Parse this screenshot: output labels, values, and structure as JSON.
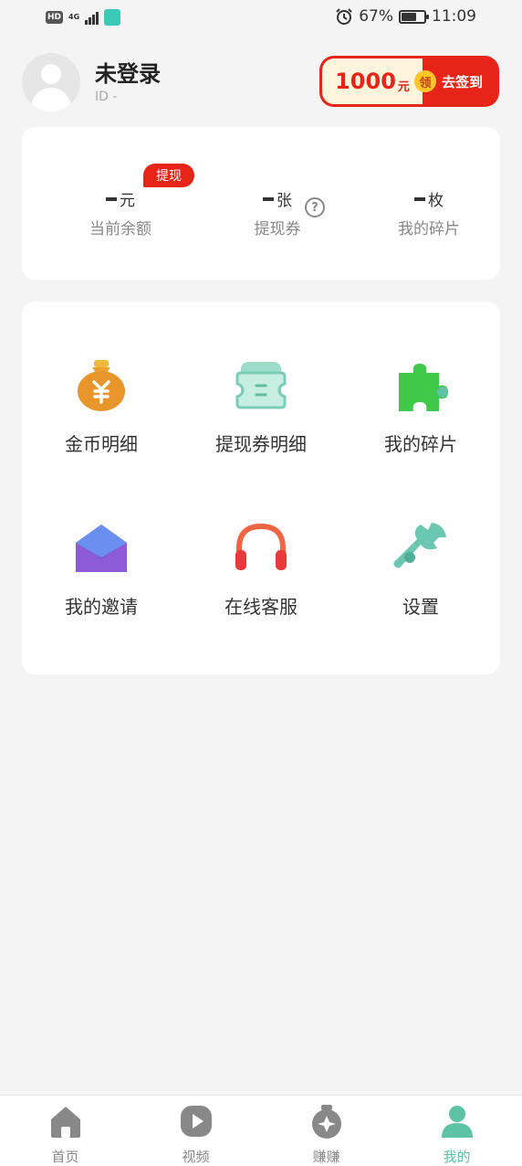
{
  "status_bar": {
    "hd": "HD",
    "network": "4G",
    "battery_text": "67%",
    "battery_level": 0.67,
    "time": "11:09",
    "icons": [
      "alarm-icon",
      "battery-icon",
      "signal-icon"
    ]
  },
  "profile": {
    "username": "未登录",
    "id_text": "ID -"
  },
  "signin": {
    "amount": "1000",
    "unit": "元",
    "coin_label": "领",
    "action": "去签到",
    "colors": {
      "accent": "#e62418",
      "bg": "#fff4dc",
      "coin": "#ffc52b"
    }
  },
  "stats": {
    "badge": "提现",
    "items": [
      {
        "unit": "元",
        "label": "当前余额"
      },
      {
        "unit": "张",
        "label": "提现券"
      },
      {
        "unit": "枚",
        "label": "我的碎片"
      }
    ]
  },
  "menu": {
    "items": [
      {
        "label": "金币明细",
        "icon": "money-bag-icon"
      },
      {
        "label": "提现券明细",
        "icon": "ticket-icon"
      },
      {
        "label": "我的碎片",
        "icon": "puzzle-icon"
      },
      {
        "label": "我的邀请",
        "icon": "envelope-icon"
      },
      {
        "label": "在线客服",
        "icon": "headphones-icon"
      },
      {
        "label": "设置",
        "icon": "wrench-icon"
      }
    ]
  },
  "tabs": {
    "active_color": "#5ec2a4",
    "items": [
      {
        "label": "首页",
        "icon": "home-icon"
      },
      {
        "label": "视频",
        "icon": "play-icon"
      },
      {
        "label": "赚赚",
        "icon": "coin-bag-icon"
      },
      {
        "label": "我的",
        "icon": "user-icon"
      }
    ]
  }
}
